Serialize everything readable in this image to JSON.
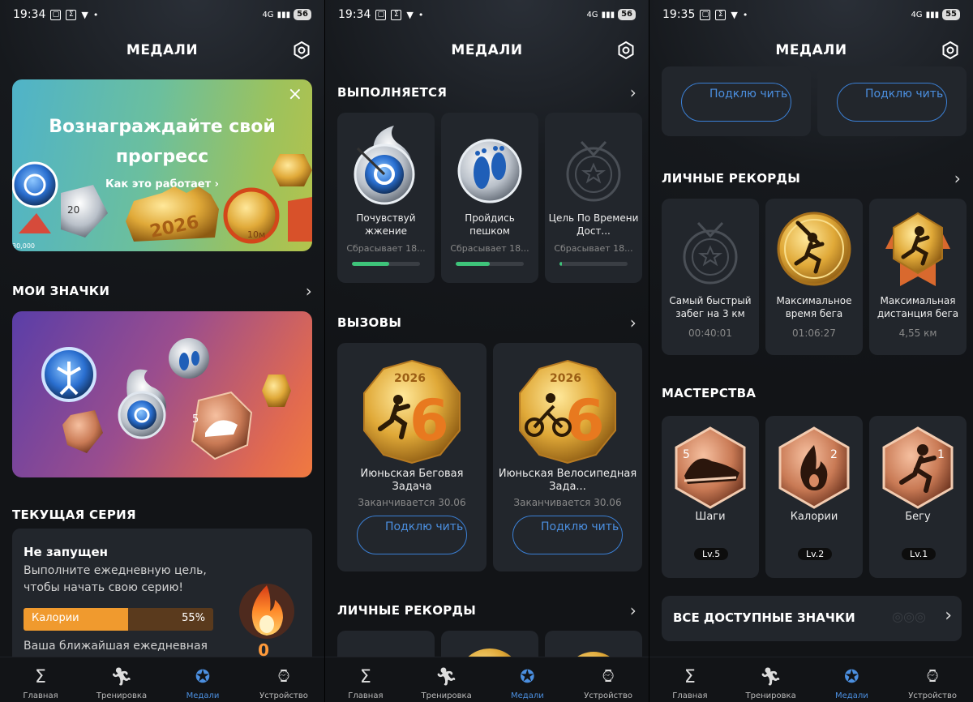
{
  "status": [
    {
      "time": "19:34",
      "battery": "56",
      "signal": "4G"
    },
    {
      "time": "19:34",
      "battery": "56",
      "signal": "4G"
    },
    {
      "time": "19:35",
      "battery": "55",
      "signal": "4G"
    }
  ],
  "header_title": "МЕДАЛИ",
  "tabs": [
    {
      "label": "Главная",
      "icon": "sigma-icon"
    },
    {
      "label": "Тренировка",
      "icon": "runner-icon"
    },
    {
      "label": "Медали",
      "icon": "medal-icon"
    },
    {
      "label": "Устройство",
      "icon": "watch-icon"
    }
  ],
  "p1": {
    "banner": {
      "title_line1": "Вознаграждайте свой",
      "title_line2": "прогресс",
      "link": "Как это работает",
      "badge_year": "2026",
      "badge_dist": "10м",
      "badge_num": "20",
      "badge_30": "30,000"
    },
    "my_badges": "МОИ ЗНАЧКИ",
    "badge_level": "5",
    "streak_title": "ТЕКУЩАЯ СЕРИЯ",
    "streak": {
      "status": "Не запущен",
      "desc": "Выполните ежедневную цель, чтобы начать свою серию!",
      "bar_label": "Калории",
      "bar_pct": "55%",
      "bar_value": 55,
      "next": "Ваша ближайшая ежедневная",
      "count": "0"
    }
  },
  "p2": {
    "in_progress": "ВЫПОЛНЯЕТСЯ",
    "progress_items": [
      {
        "name": "Почувствуй жжение",
        "reset": "Сбрасывает 18...",
        "progress": 0.55
      },
      {
        "name": "Пройдись пешком",
        "reset": "Сбрасывает 18...",
        "progress": 0.5
      },
      {
        "name": "Цель По Времени Дост...",
        "reset": "Сбрасывает 18...",
        "progress": 0.03
      }
    ],
    "challenges": "ВЫЗОВЫ",
    "challenge_items": [
      {
        "name": "Июньская Беговая Задача",
        "ends": "Заканчивается 30.06",
        "year": "2026",
        "num": "6",
        "button": "Подклю чить"
      },
      {
        "name": "Июньская Велосипедная Зада...",
        "ends": "Заканчивается 30.06",
        "year": "2026",
        "num": "6",
        "button": "Подклю чить"
      }
    ],
    "records": "ЛИЧНЫЕ РЕКОРДЫ"
  },
  "p3": {
    "buttons": [
      "Подклю чить",
      "Подклю чить"
    ],
    "records": "ЛИЧНЫЕ РЕКОРДЫ",
    "record_items": [
      {
        "name": "Самый быстрый забег на 3 км",
        "value": "00:40:01"
      },
      {
        "name": "Максимальное время бега",
        "value": "01:06:27"
      },
      {
        "name": "Максимальная дистанция бега",
        "value": "4,55 км"
      }
    ],
    "mastery": "МАСТЕРСТВА",
    "mastery_items": [
      {
        "name": "Шаги",
        "level": "Lv.5",
        "num": "5"
      },
      {
        "name": "Калории",
        "level": "Lv.2",
        "num": "2"
      },
      {
        "name": "Бегу",
        "level": "Lv.1",
        "num": "1"
      }
    ],
    "all_badges": "ВСЕ ДОСТУПНЫЕ ЗНАЧКИ"
  },
  "colors": {
    "accent": "#4b8fe0",
    "progress": "#3ec47a",
    "calorie_bar": "#f09a2e",
    "card": "#22262c"
  }
}
